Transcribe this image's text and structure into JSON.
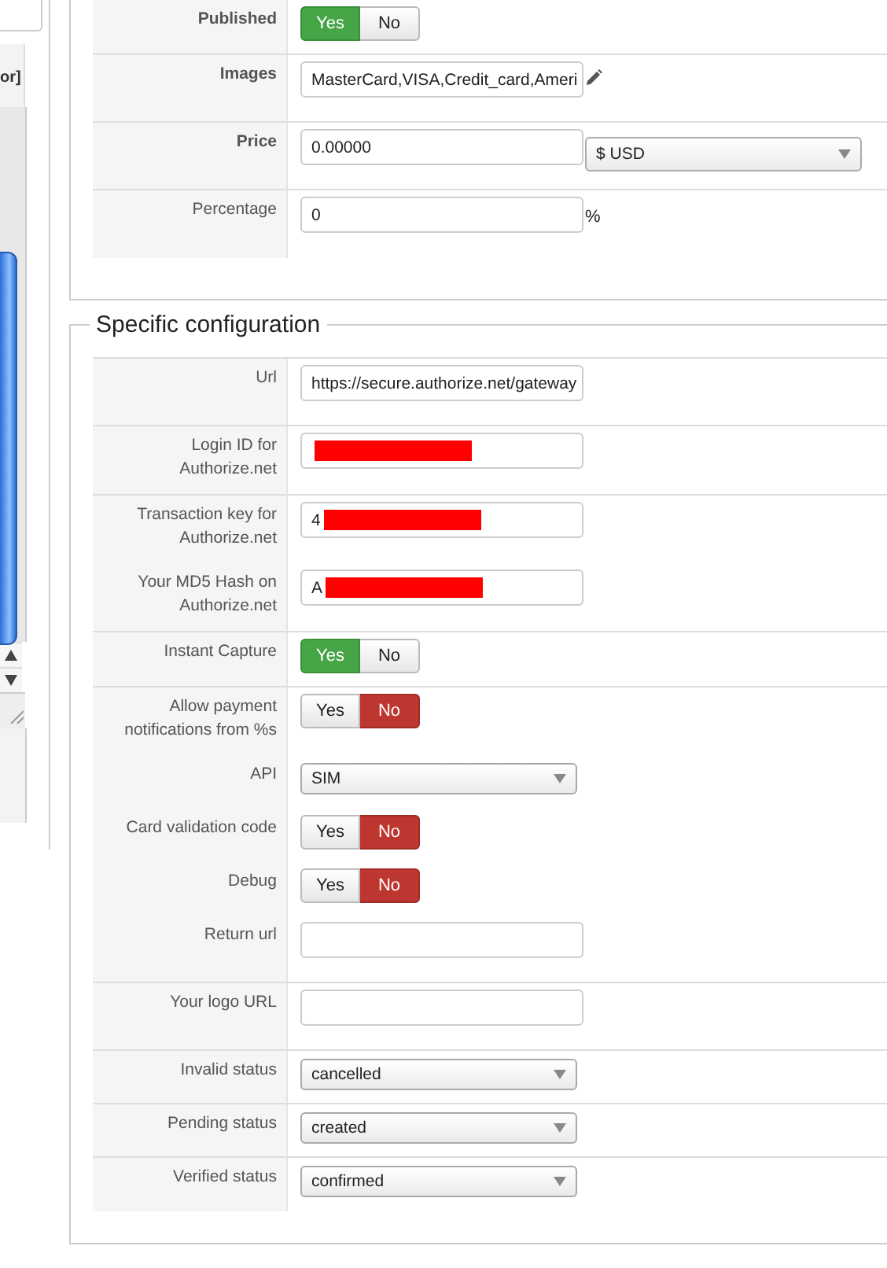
{
  "side_panel": {
    "header_text": "or]"
  },
  "sections": [
    {
      "rows": [
        {
          "label": "Published",
          "bold": true,
          "divider": true,
          "controls": [
            {
              "kind": "toggle",
              "options": [
                {
                  "label": "Yes",
                  "selected": true
                },
                {
                  "label": "No",
                  "selected": false
                }
              ]
            }
          ]
        },
        {
          "label": "Images",
          "bold": true,
          "divider": true,
          "controls": [
            {
              "kind": "input",
              "value": "MasterCard,VISA,Credit_card,Ameri"
            },
            {
              "kind": "pencil"
            }
          ]
        },
        {
          "label": "Price",
          "bold": true,
          "divider": true,
          "controls": [
            {
              "kind": "input",
              "value": "0.00000"
            },
            {
              "kind": "select",
              "value": "$ USD",
              "wide": true
            }
          ]
        },
        {
          "label": "Percentage",
          "bold": false,
          "divider": false,
          "controls": [
            {
              "kind": "input",
              "value": "0"
            },
            {
              "kind": "suffix",
              "text": "%"
            }
          ]
        }
      ]
    },
    {
      "legend": "Specific configuration",
      "rows": [
        {
          "label": "Url",
          "bold": false,
          "divider": true,
          "controls": [
            {
              "kind": "input",
              "value": "https://secure.authorize.net/gateway"
            }
          ]
        },
        {
          "label": "Login ID for Authorize.net",
          "bold": false,
          "divider": true,
          "controls": [
            {
              "kind": "input",
              "redacted": true
            }
          ]
        },
        {
          "label": "Transaction key for Authorize.net",
          "bold": false,
          "divider": false,
          "controls": [
            {
              "kind": "input",
              "value": "4",
              "redacted": true
            }
          ]
        },
        {
          "label": "Your MD5 Hash on Authorize.net",
          "bold": false,
          "divider": true,
          "controls": [
            {
              "kind": "input",
              "value": "A",
              "redacted": true
            }
          ]
        },
        {
          "label": "Instant Capture",
          "bold": false,
          "divider": true,
          "controls": [
            {
              "kind": "toggle",
              "options": [
                {
                  "label": "Yes",
                  "selected": true
                },
                {
                  "label": "No",
                  "selected": false
                }
              ]
            }
          ]
        },
        {
          "label": "Allow payment notifications from %s",
          "bold": false,
          "divider": false,
          "controls": [
            {
              "kind": "toggle",
              "options": [
                {
                  "label": "Yes",
                  "selected": false
                },
                {
                  "label": "No",
                  "selected": true
                }
              ]
            }
          ]
        },
        {
          "label": "API",
          "bold": false,
          "divider": false,
          "controls": [
            {
              "kind": "select",
              "value": "SIM"
            }
          ]
        },
        {
          "label": "Card validation code",
          "bold": false,
          "divider": false,
          "controls": [
            {
              "kind": "toggle",
              "options": [
                {
                  "label": "Yes",
                  "selected": false
                },
                {
                  "label": "No",
                  "selected": true
                }
              ]
            }
          ]
        },
        {
          "label": "Debug",
          "bold": false,
          "divider": false,
          "controls": [
            {
              "kind": "toggle",
              "options": [
                {
                  "label": "Yes",
                  "selected": false
                },
                {
                  "label": "No",
                  "selected": true
                }
              ]
            }
          ]
        },
        {
          "label": "Return url",
          "bold": false,
          "divider": true,
          "controls": [
            {
              "kind": "input"
            }
          ]
        },
        {
          "label": "Your logo URL",
          "bold": false,
          "divider": true,
          "controls": [
            {
              "kind": "input"
            }
          ]
        },
        {
          "label": "Invalid status",
          "bold": false,
          "divider": true,
          "controls": [
            {
              "kind": "select",
              "value": "cancelled"
            }
          ]
        },
        {
          "label": "Pending status",
          "bold": false,
          "divider": true,
          "controls": [
            {
              "kind": "select",
              "value": "created"
            }
          ]
        },
        {
          "label": "Verified status",
          "bold": false,
          "divider": false,
          "controls": [
            {
              "kind": "select",
              "value": "confirmed"
            }
          ]
        }
      ]
    }
  ]
}
